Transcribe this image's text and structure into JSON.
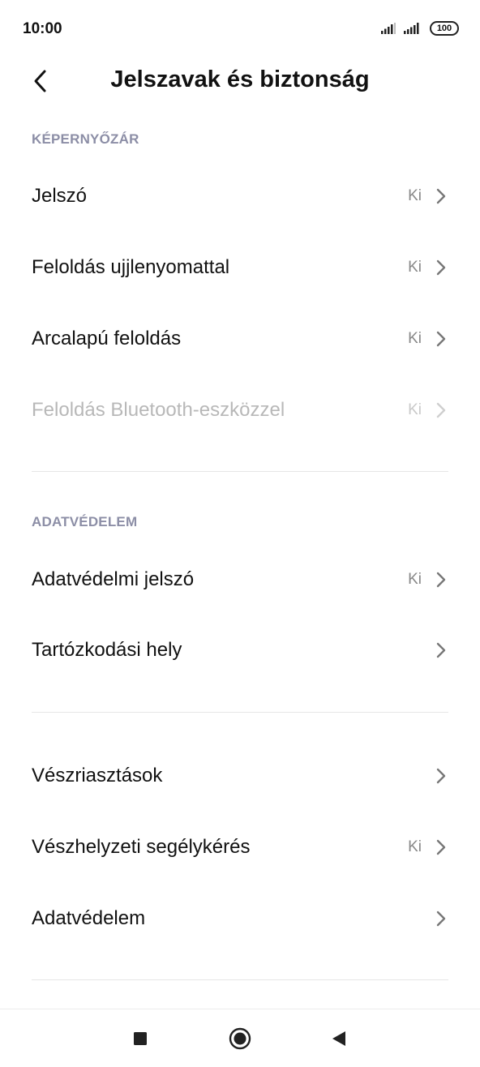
{
  "status_bar": {
    "time": "10:00",
    "battery": "100",
    "icons": [
      "signal-icon",
      "signal-icon",
      "battery-icon"
    ]
  },
  "header": {
    "back_icon": "chevron-left-icon",
    "title": "Jelszavak és biztonság"
  },
  "sections": [
    {
      "label": "KÉPERNYŐZÁR",
      "items": [
        {
          "label": "Jelszó",
          "value": "Ki",
          "enabled": true
        },
        {
          "label": "Feloldás ujjlenyomattal",
          "value": "Ki",
          "enabled": true
        },
        {
          "label": "Arcalapú feloldás",
          "value": "Ki",
          "enabled": true
        },
        {
          "label": "Feloldás Bluetooth-eszközzel",
          "value": "Ki",
          "enabled": false
        }
      ]
    },
    {
      "label": "ADATVÉDELEM",
      "items": [
        {
          "label": "Adatvédelmi jelszó",
          "value": "Ki",
          "enabled": true
        },
        {
          "label": "Tartózkodási hely",
          "value": "",
          "enabled": true
        }
      ]
    },
    {
      "label": "",
      "items": [
        {
          "label": "Vészriasztások",
          "value": "",
          "enabled": true
        },
        {
          "label": "Vészhelyzeti segélykérés",
          "value": "Ki",
          "enabled": true
        },
        {
          "label": "Adatvédelem",
          "value": "",
          "enabled": true
        }
      ]
    }
  ],
  "nav_bar": {
    "icons": [
      "square-icon",
      "circle-icon",
      "triangle-back-icon"
    ]
  },
  "colors": {
    "section_label": "#8c8ea6",
    "text": "#111111",
    "value": "#888888",
    "disabled": "#b8b8b8",
    "divider": "#e6e6e6"
  }
}
